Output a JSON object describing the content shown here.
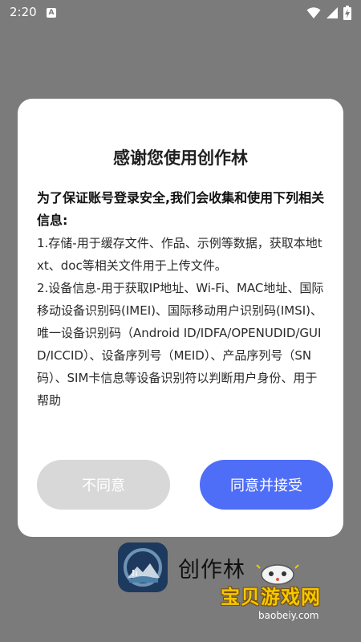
{
  "status_bar": {
    "time": "2:20",
    "notification_icon": "a-letter-icon",
    "icons": [
      "wifi-icon",
      "signal-icon",
      "battery-charging-icon"
    ]
  },
  "dialog": {
    "title": "感谢您使用创作林",
    "intro": "为了保证账号登录安全,我们会收集和使用下列相关信息:",
    "items": [
      "1.存储-用于缓存文件、作品、示例等数据，获取本地txt、doc等相关文件用于上传文件。",
      "2.设备信息-用于获取IP地址、Wi-Fi、MAC地址、国际移动设备识别码(IMEI)、国际移动用户识别码(IMSI)、唯一设备识别码（Android ID/IDFA/OPENUDID/GUID/ICCID）、设备序列号（MEID）、产品序列号（SN码）、SIM卡信息等设备识别符以判断用户身份、用于帮助"
    ],
    "disagree_label": "不同意",
    "agree_label": "同意并接受"
  },
  "app": {
    "name": "创作林",
    "logo_icon": "mountain-landscape-logo-icon"
  },
  "watermark": {
    "text": "宝贝游戏网",
    "url": "baobeiy.com",
    "mascot_icon": "gamepad-mascot-icon"
  },
  "colors": {
    "overlay_bg": "#7b7b7b",
    "agree_button": "#4f6ef7",
    "disagree_button": "#d8d8d8",
    "watermark_text": "#f5c800"
  }
}
